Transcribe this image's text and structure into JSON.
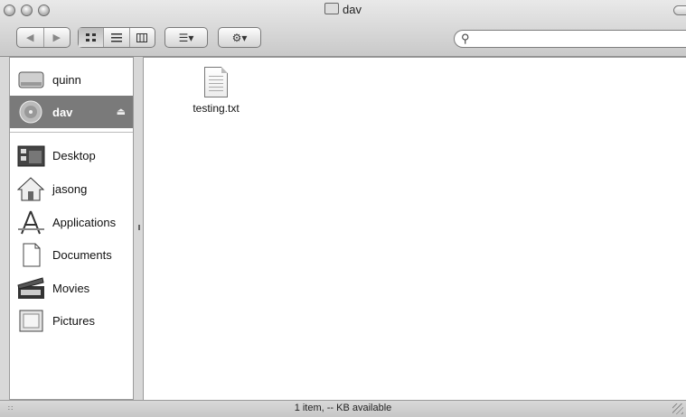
{
  "window": {
    "title": "dav",
    "title_icon": "network-volume-icon"
  },
  "toolbar": {
    "back_forward": [
      "◀",
      "▶"
    ],
    "view_modes": [
      "icon-view",
      "list-view",
      "column-view"
    ],
    "arrange_label": "☰▾",
    "action_label": "⚙▾",
    "search_placeholder": ""
  },
  "sidebar": {
    "devices": [
      {
        "label": "quinn",
        "icon": "hard-drive-icon",
        "selected": false
      },
      {
        "label": "dav",
        "icon": "network-disk-icon",
        "selected": true,
        "ejectable": true
      }
    ],
    "places": [
      {
        "label": "Desktop",
        "icon": "desktop-icon"
      },
      {
        "label": "jasong",
        "icon": "home-icon"
      },
      {
        "label": "Applications",
        "icon": "applications-icon"
      },
      {
        "label": "Documents",
        "icon": "documents-icon"
      },
      {
        "label": "Movies",
        "icon": "movies-icon"
      },
      {
        "label": "Pictures",
        "icon": "pictures-icon"
      }
    ]
  },
  "main": {
    "files": [
      {
        "name": "testing.txt",
        "icon": "text-document-icon"
      }
    ]
  },
  "status": {
    "text": "1 item, -- KB available"
  }
}
